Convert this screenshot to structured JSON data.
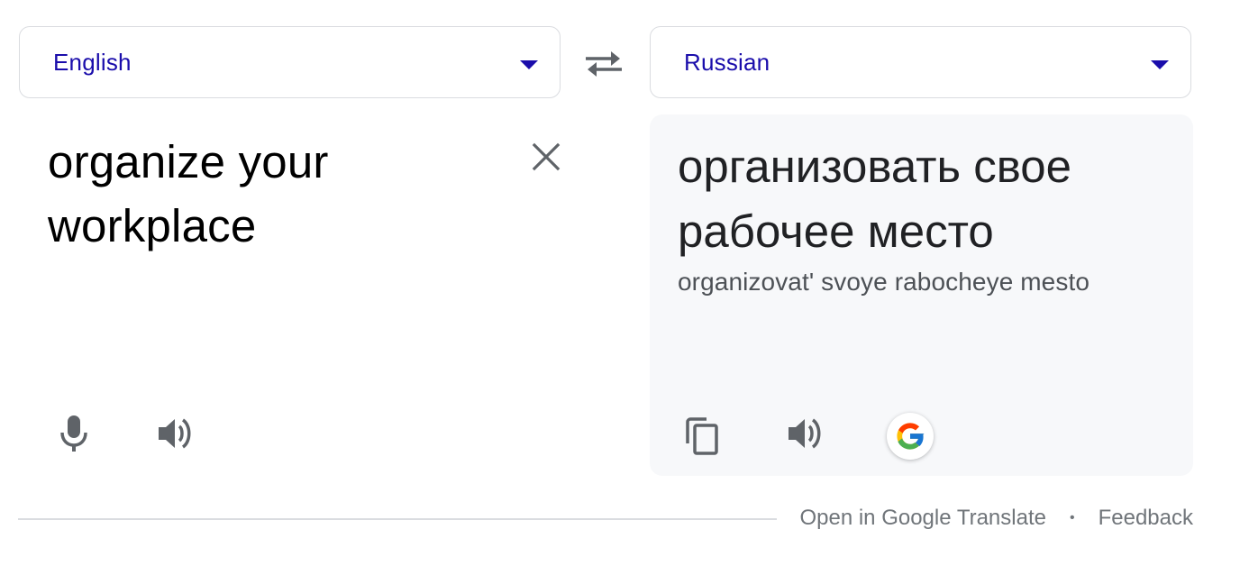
{
  "source_language": {
    "label": "English",
    "icon": "chevron-down-icon",
    "accent_color": "#1a0dab"
  },
  "target_language": {
    "label": "Russian",
    "icon": "chevron-down-icon"
  },
  "swap": {
    "icon": "swap-languages-icon"
  },
  "source": {
    "line1": "organize your",
    "line2": "workplace",
    "clear_icon": "close-icon",
    "mic_icon": "microphone-icon",
    "speaker_icon": "speaker-icon"
  },
  "target": {
    "line1": "организовать свое",
    "line2": "рабочее место",
    "transliteration": "organizovat' svoye rabocheye mesto",
    "copy_icon": "copy-icon",
    "speaker_icon": "speaker-icon",
    "google_icon": "google-logo-icon"
  },
  "footer": {
    "open_link": "Open in Google Translate",
    "separator": "•",
    "feedback_link": "Feedback"
  }
}
